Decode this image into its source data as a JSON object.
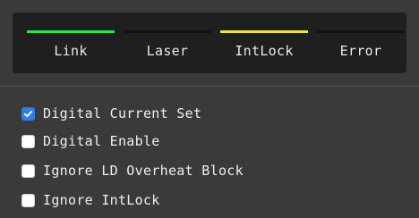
{
  "status_panel": {
    "indicators": [
      {
        "label": "Link",
        "color": "#2ee84a"
      },
      {
        "label": "Laser",
        "color": "#111111"
      },
      {
        "label": "IntLock",
        "color": "#f2e23a"
      },
      {
        "label": "Error",
        "color": "#111111"
      }
    ]
  },
  "options": [
    {
      "label": "Digital Current Set",
      "checked": true,
      "icon": "check-icon"
    },
    {
      "label": "Digital Enable",
      "checked": false
    },
    {
      "label": "Ignore LD Overheat Block",
      "checked": false
    },
    {
      "label": "Ignore IntLock",
      "checked": false
    }
  ],
  "colors": {
    "accent": "#2f7ee8",
    "panel_bg": "#1f1f1f",
    "window_bg": "#3a3a3a"
  }
}
